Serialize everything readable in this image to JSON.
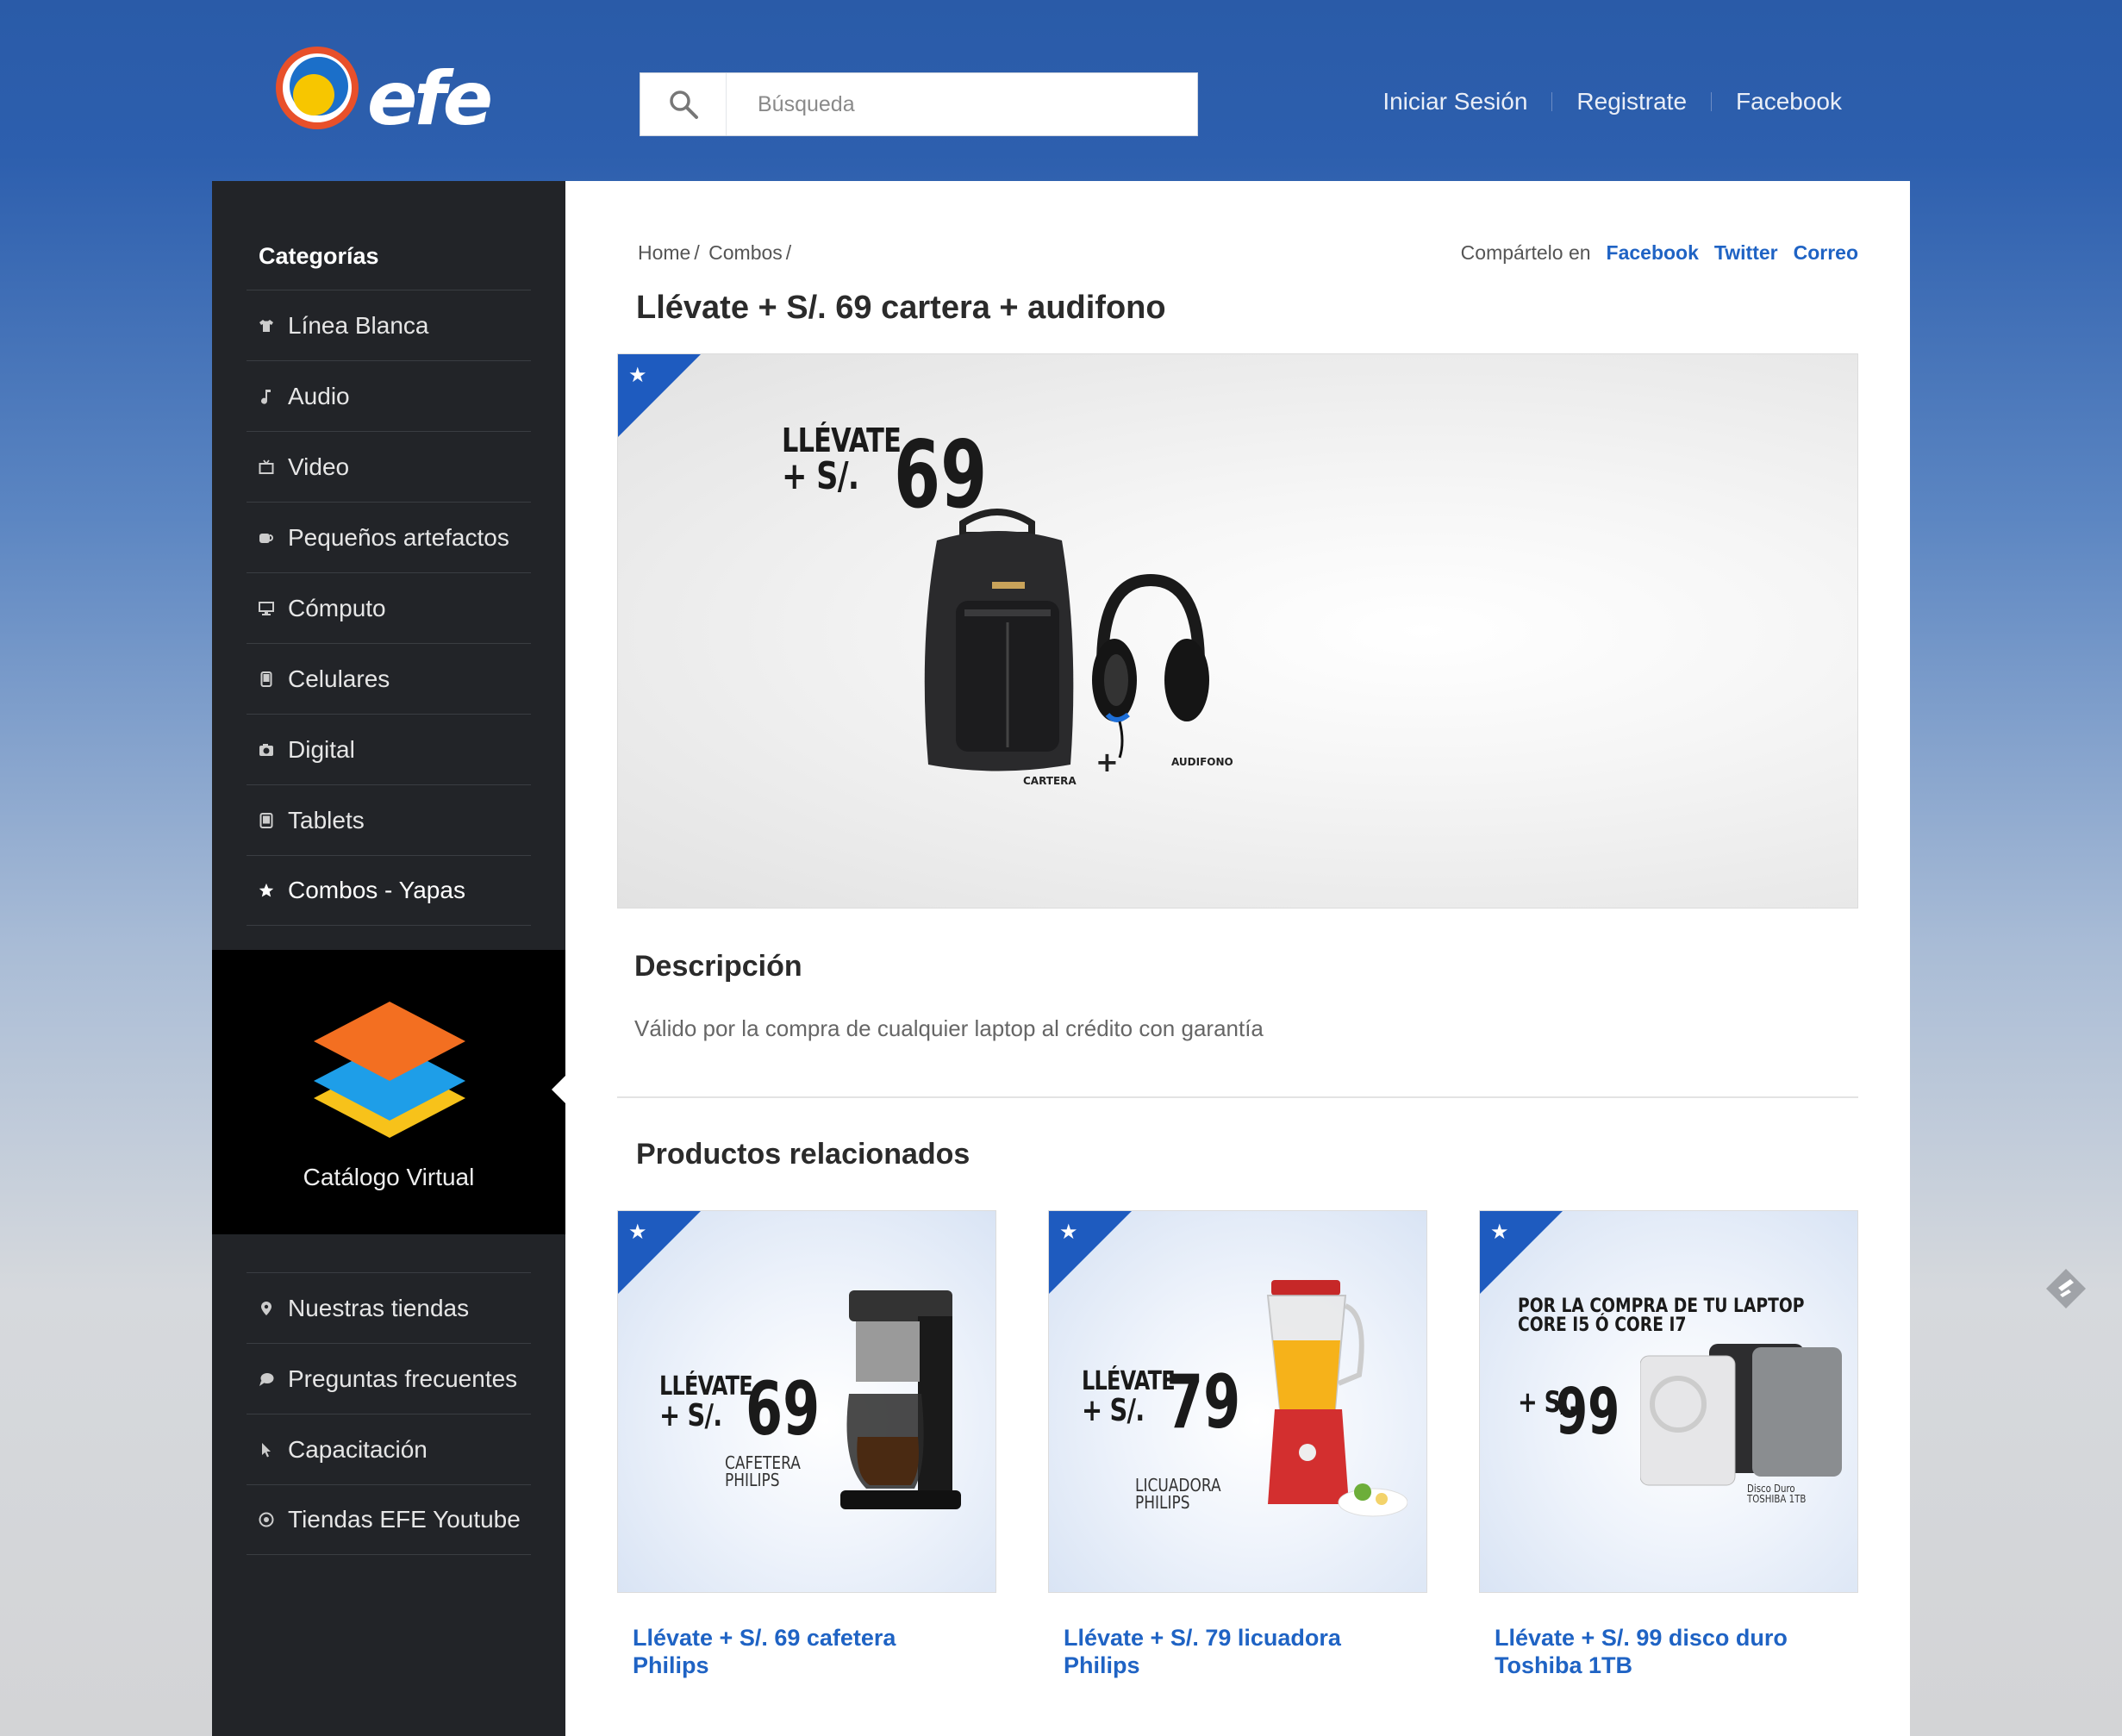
{
  "header": {
    "logo_text": "efe",
    "search_placeholder": "Búsqueda",
    "nav": [
      "Iniciar Sesión",
      "Registrate",
      "Facebook"
    ]
  },
  "sidebar": {
    "title": "Categorías",
    "categories": [
      {
        "label": "Línea Blanca",
        "icon": "shirt-icon"
      },
      {
        "label": "Audio",
        "icon": "music-note-icon"
      },
      {
        "label": "Video",
        "icon": "tv-icon"
      },
      {
        "label": "Pequeños artefactos",
        "icon": "mug-icon"
      },
      {
        "label": "Cómputo",
        "icon": "monitor-icon"
      },
      {
        "label": "Celulares",
        "icon": "phone-icon"
      },
      {
        "label": "Digital",
        "icon": "camera-icon"
      },
      {
        "label": "Tablets",
        "icon": "tablet-icon"
      },
      {
        "label": "Combos - Yapas",
        "icon": "star-icon"
      }
    ],
    "catalog_label": "Catálogo Virtual",
    "links": [
      {
        "label": "Nuestras tiendas",
        "icon": "map-pin-icon"
      },
      {
        "label": "Preguntas frecuentes",
        "icon": "speech-bubble-icon"
      },
      {
        "label": "Capacitación",
        "icon": "cursor-icon"
      },
      {
        "label": "Tiendas EFE Youtube",
        "icon": "play-circle-icon"
      }
    ]
  },
  "main": {
    "breadcrumb": [
      "Home",
      "/",
      "Combos",
      "/"
    ],
    "share_label": "Compártelo en",
    "share_links": [
      "Facebook",
      "Twitter",
      "Correo"
    ],
    "title": "Llévate + S/. 69 cartera + audifono",
    "hero": {
      "line1": "LLÉVATE",
      "line2": "+ S/.",
      "price": "69",
      "item1": "CARTERA",
      "plus": "+",
      "item2": "AUDIFONO"
    },
    "description_title": "Descripción",
    "description_text": "Válido por la compra de cualquier laptop al crédito con garantía",
    "related_title": "Productos relacionados",
    "related": [
      {
        "title": "Llévate + S/. 69 cafetera Philips",
        "line1": "LLÉVATE",
        "line2": "+ S/.",
        "price": "69",
        "sub1": "CAFETERA",
        "sub2": "PHILIPS"
      },
      {
        "title": "Llévate + S/. 79 licuadora Philips",
        "line1": "LLÉVATE",
        "line2": "+ S/.",
        "price": "79",
        "sub1": "LICUADORA",
        "sub2": "PHILIPS"
      },
      {
        "title": "Llévate + S/. 99 disco duro Toshiba 1TB",
        "head1": "POR LA COMPRA DE TU LAPTOP",
        "head2": "CORE I5 Ó  CORE I7",
        "line2": "+ S/.",
        "price": "99",
        "sub1": "Disco Duro",
        "sub2": "TOSHIBA 1TB"
      }
    ]
  },
  "colors": {
    "header_blue": "#2a5ba8",
    "link_blue": "#1f63c4",
    "sidebar_bg": "#222428",
    "corner_blue": "#1e5bbf"
  }
}
